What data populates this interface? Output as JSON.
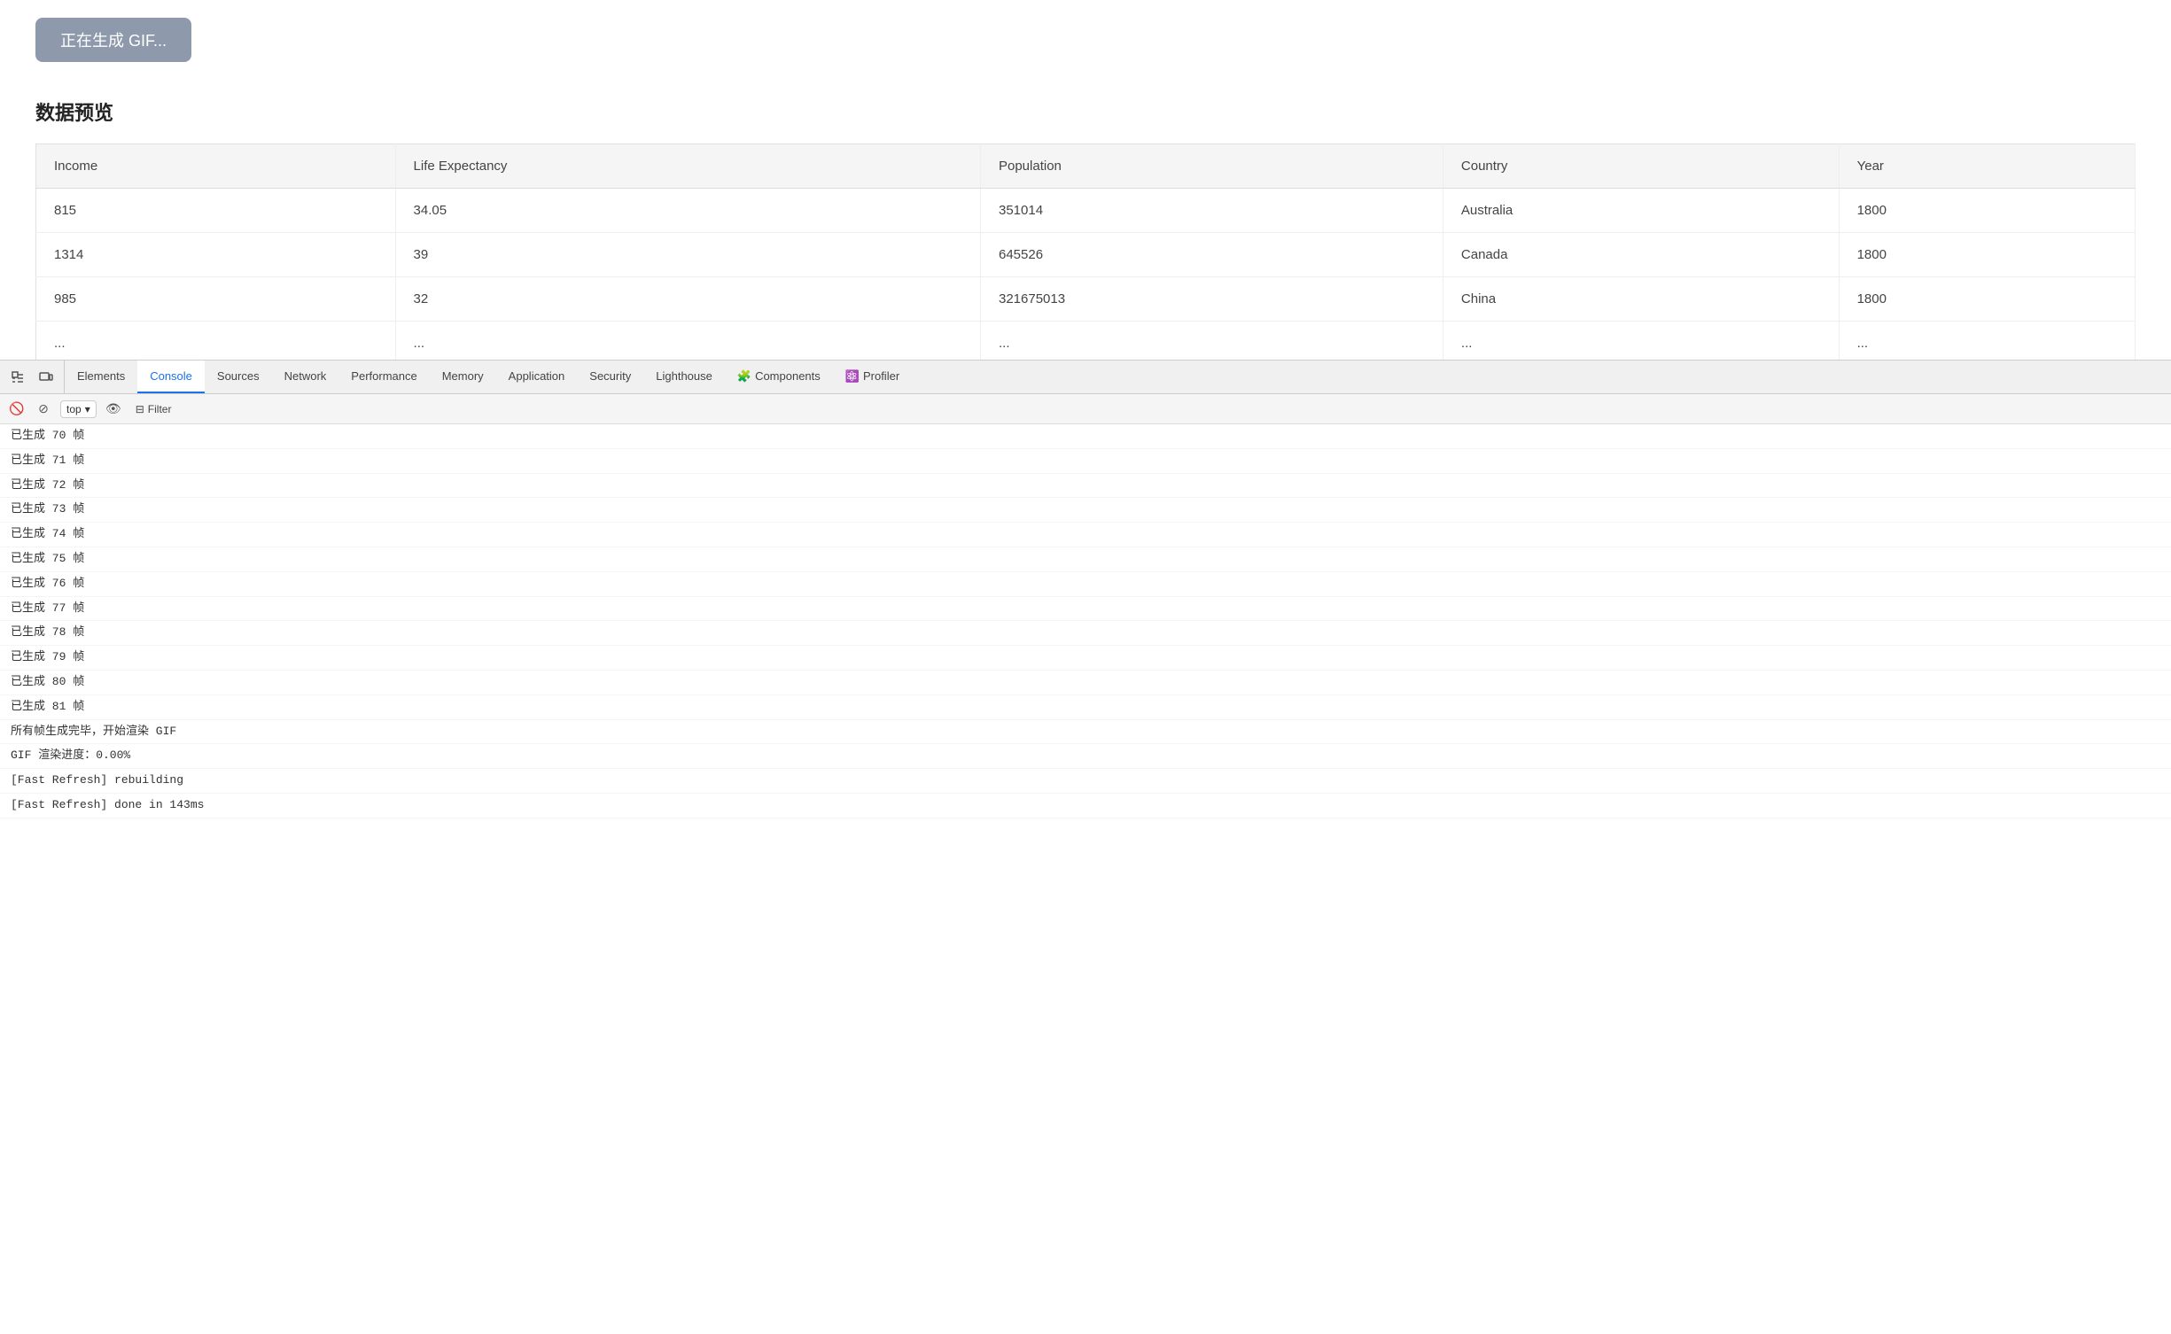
{
  "page": {
    "generate_button_label": "正在生成 GIF...",
    "section_title": "数据预览"
  },
  "table": {
    "headers": [
      "Income",
      "Life Expectancy",
      "Population",
      "Country",
      "Year"
    ],
    "rows": [
      [
        "815",
        "34.05",
        "351014",
        "Australia",
        "1800"
      ],
      [
        "1314",
        "39",
        "645526",
        "Canada",
        "1800"
      ],
      [
        "985",
        "32",
        "321675013",
        "China",
        "1800"
      ],
      [
        "...",
        "...",
        "...",
        "...",
        "..."
      ]
    ]
  },
  "devtools": {
    "tabs": [
      {
        "label": "Elements",
        "active": false
      },
      {
        "label": "Console",
        "active": true
      },
      {
        "label": "Sources",
        "active": false
      },
      {
        "label": "Network",
        "active": false
      },
      {
        "label": "Performance",
        "active": false
      },
      {
        "label": "Memory",
        "active": false
      },
      {
        "label": "Application",
        "active": false
      },
      {
        "label": "Security",
        "active": false
      },
      {
        "label": "Lighthouse",
        "active": false
      },
      {
        "label": "Components",
        "active": false,
        "icon": "🧩"
      },
      {
        "label": "Profiler",
        "active": false,
        "icon": "⚛️"
      }
    ],
    "context": "top",
    "filter_placeholder": "Filter",
    "console_lines": [
      "已生成 70 帧",
      "已生成 71 帧",
      "已生成 72 帧",
      "已生成 73 帧",
      "已生成 74 帧",
      "已生成 75 帧",
      "已生成 76 帧",
      "已生成 77 帧",
      "已生成 78 帧",
      "已生成 79 帧",
      "已生成 80 帧",
      "已生成 81 帧",
      "所有帧生成完毕，开始渲染 GIF",
      "GIF 渲染进度：0.00%",
      "[Fast Refresh] rebuilding",
      "[Fast Refresh] done in 143ms"
    ]
  }
}
